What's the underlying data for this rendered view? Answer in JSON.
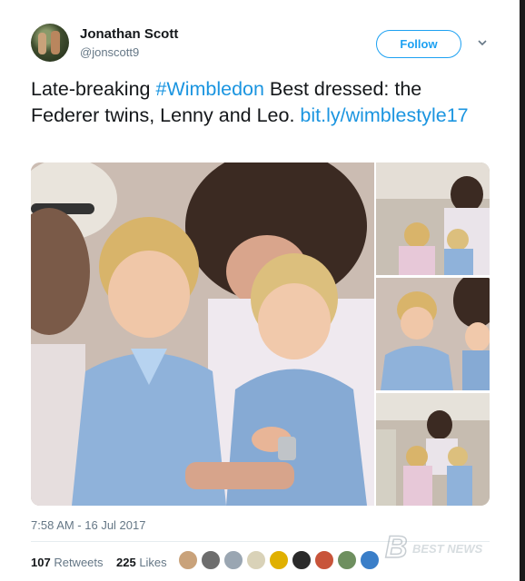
{
  "tweet": {
    "author_name": "Jonathan Scott",
    "author_handle": "@jonscott9",
    "follow_label": "Follow",
    "text_parts": {
      "part1": "Late-breaking ",
      "hashtag": "#Wimbledon",
      "part2": " Best dressed: the Federer twins, Lenny and Leo. ",
      "link": "bit.ly/wimblestyle17"
    },
    "timestamp": "7:58 AM - 16 Jul 2017",
    "retweets_count": "107",
    "retweets_label": "Retweets",
    "likes_count": "225",
    "likes_label": "Likes"
  },
  "watermark": "BEST NEWS",
  "colors": {
    "link": "#1b95e0",
    "follow": "#1da1f2",
    "secondary_text": "#657786"
  },
  "likers": [
    {
      "color": "#c9a27a"
    },
    {
      "color": "#6d6d6d"
    },
    {
      "color": "#9aa6b2"
    },
    {
      "color": "#d9d2b8"
    },
    {
      "color": "#e0b000"
    },
    {
      "color": "#2a2a2a"
    },
    {
      "color": "#c8543a"
    },
    {
      "color": "#6e8f5f"
    },
    {
      "color": "#3a7ec8"
    }
  ]
}
